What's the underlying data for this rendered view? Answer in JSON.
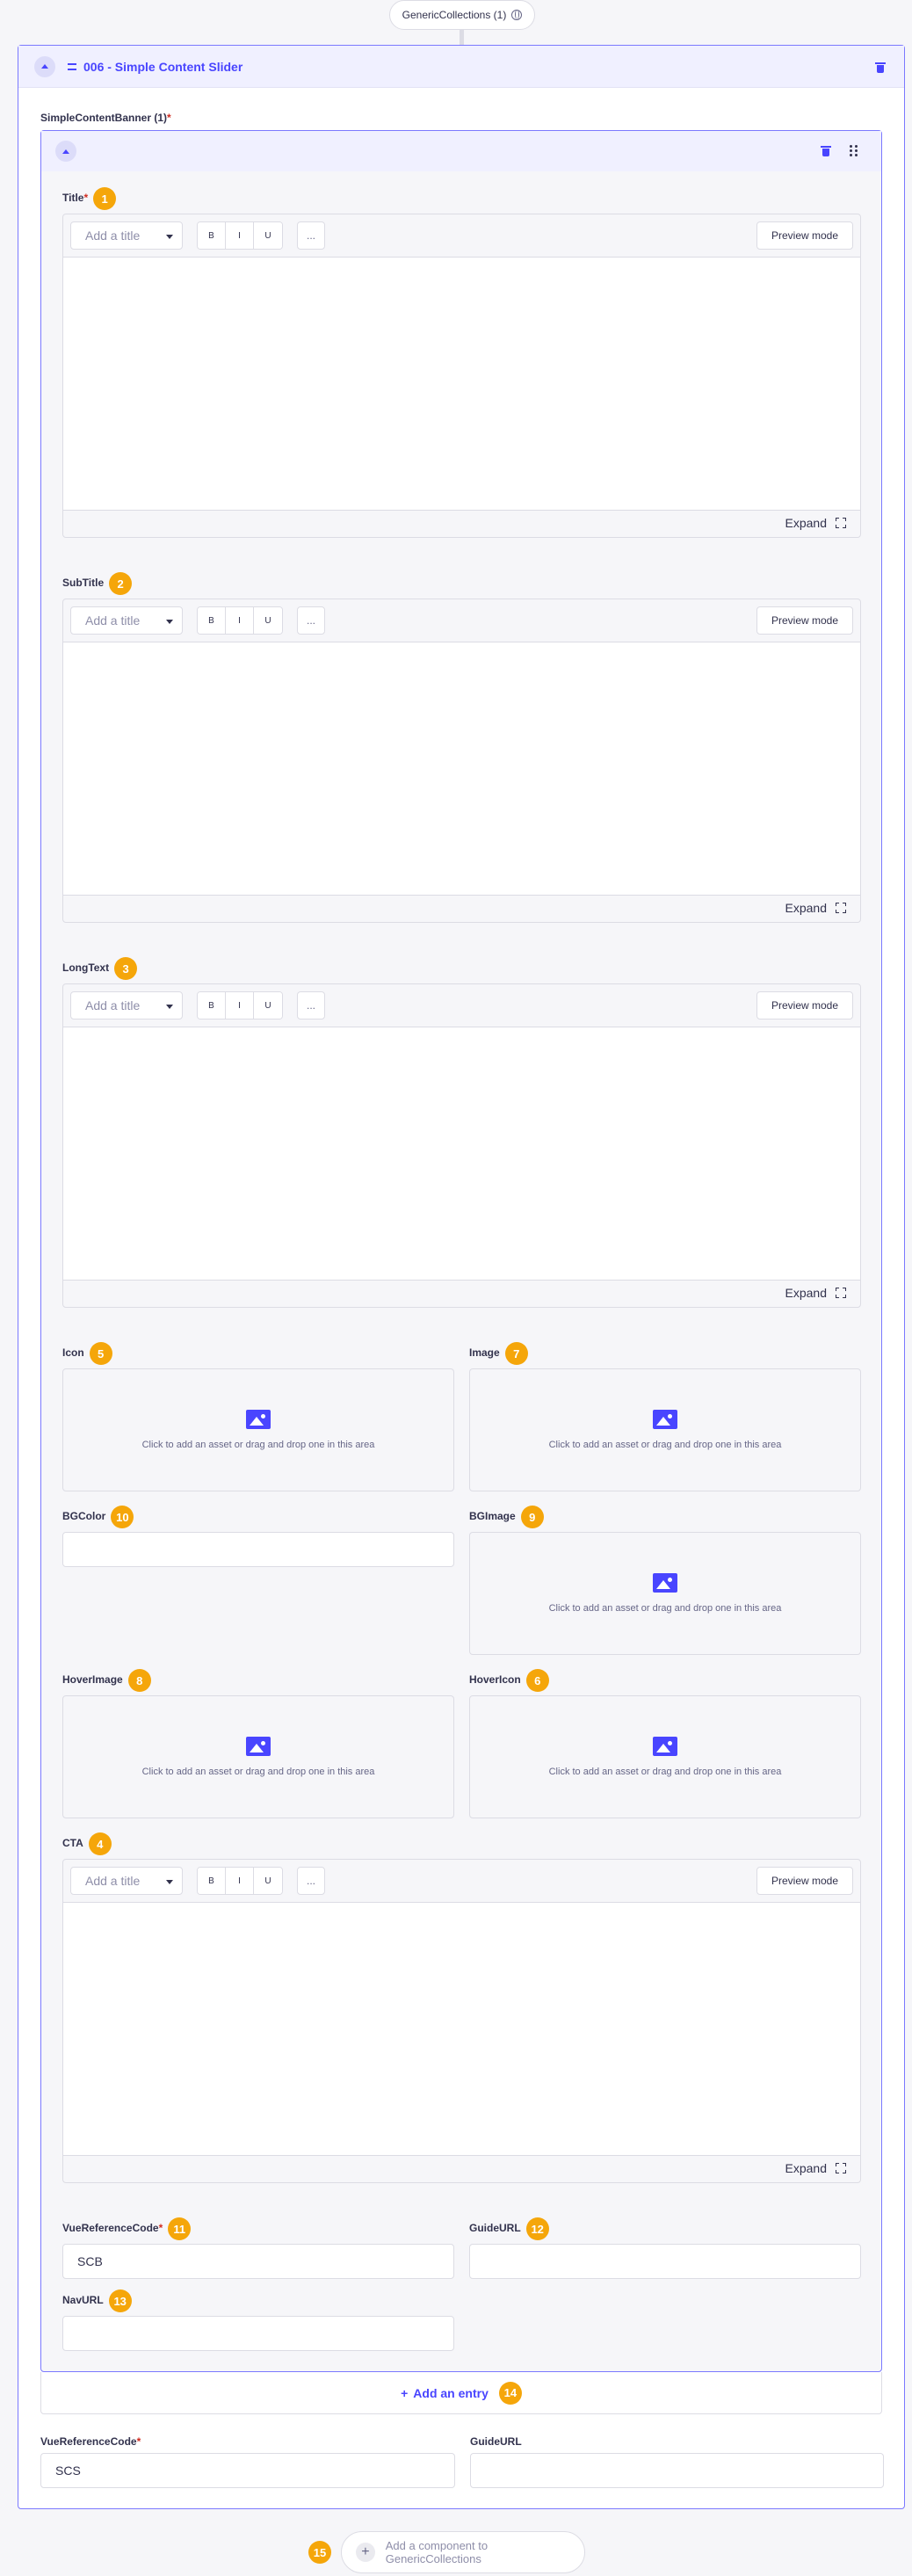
{
  "top_pill": {
    "label": "GenericCollections (1)",
    "icon": "globe-icon"
  },
  "outer_component": {
    "title": "006 - Simple Content Slider",
    "banner_label": "SimpleContentBanner (1)",
    "required_mark": "*"
  },
  "editor": {
    "title_placeholder": "Add a title",
    "bold": "B",
    "italic": "I",
    "underline": "U",
    "more": "...",
    "preview_label": "Preview mode",
    "expand_label": "Expand"
  },
  "fields": {
    "title": {
      "label": "Title",
      "required": "*",
      "badge": "1"
    },
    "subtitle": {
      "label": "SubTitle",
      "badge": "2"
    },
    "longtext": {
      "label": "LongText",
      "badge": "3"
    },
    "icon": {
      "label": "Icon",
      "badge": "5"
    },
    "image": {
      "label": "Image",
      "badge": "7"
    },
    "bgcolor": {
      "label": "BGColor",
      "badge": "10",
      "value": ""
    },
    "bgimage": {
      "label": "BGImage",
      "badge": "9"
    },
    "hoverimage": {
      "label": "HoverImage",
      "badge": "8"
    },
    "hovericon": {
      "label": "HoverIcon",
      "badge": "6"
    },
    "cta": {
      "label": "CTA",
      "badge": "4"
    },
    "vue_ref": {
      "label": "VueReferenceCode",
      "required": "*",
      "badge": "11",
      "value": "SCB"
    },
    "guide_url": {
      "label": "GuideURL",
      "badge": "12",
      "value": ""
    },
    "nav_url": {
      "label": "NavURL",
      "badge": "13",
      "value": ""
    }
  },
  "asset_text": "Click to add an asset or drag and drop one in this area",
  "add_entry": {
    "label": "Add an entry",
    "badge": "14"
  },
  "outer_fields": {
    "vue_ref": {
      "label": "VueReferenceCode",
      "required": "*",
      "value": "SCS"
    },
    "guide_url": {
      "label": "GuideURL",
      "value": ""
    }
  },
  "add_component": {
    "label": "Add a component to GenericCollections",
    "badge": "15"
  }
}
